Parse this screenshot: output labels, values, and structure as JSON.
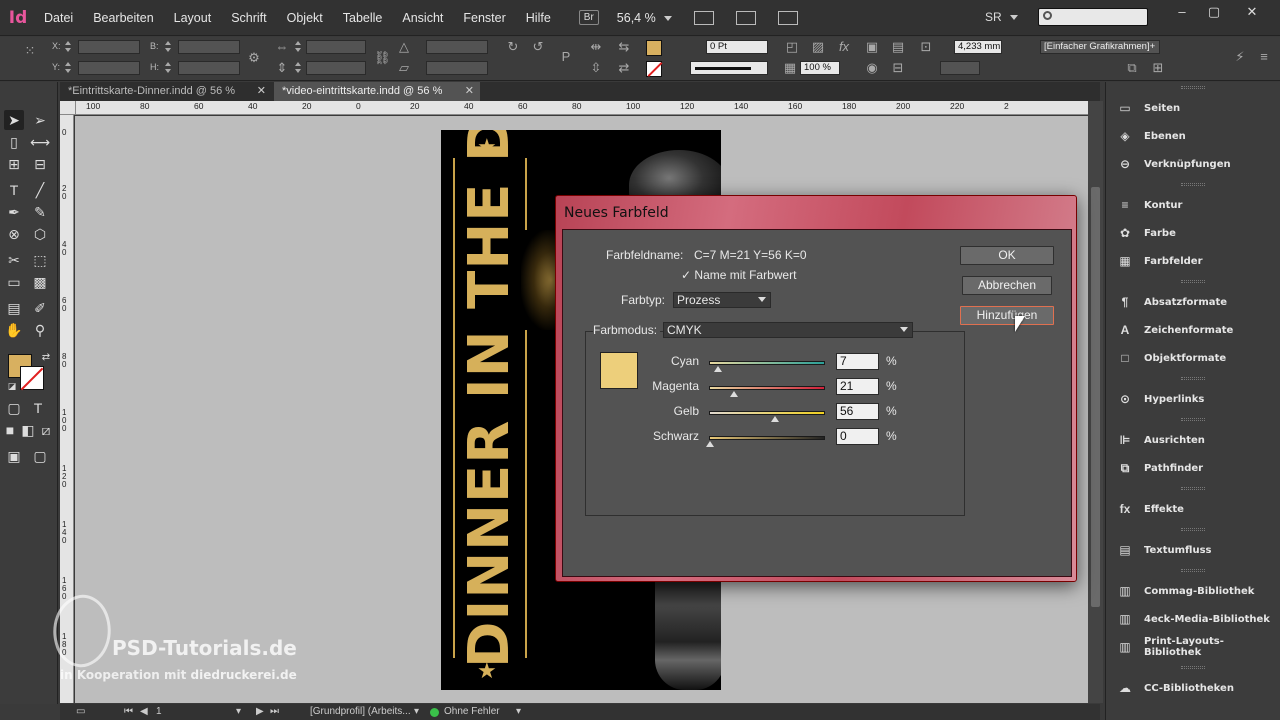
{
  "app": {
    "logo": "Id",
    "menu": [
      "Datei",
      "Bearbeiten",
      "Layout",
      "Schrift",
      "Objekt",
      "Tabelle",
      "Ansicht",
      "Fenster",
      "Hilfe"
    ],
    "bridge_label": "Br",
    "zoom": "56,4 %",
    "workspace": "SR",
    "window_controls": [
      "–",
      "▢",
      "✕"
    ]
  },
  "controlbar": {
    "x_label": "X:",
    "y_label": "Y:",
    "w_label": "B:",
    "h_label": "H:",
    "stroke_weight": "0 Pt",
    "opacity": "100 %",
    "dimension": "4,233 mm",
    "frame_style": "[Einfacher Grafikrahmen]+",
    "fill_color": "#d8b060"
  },
  "tabs": [
    {
      "label": "*Eintrittskarte-Dinner.indd @ 56 %",
      "close": "✕"
    },
    {
      "label": "*video-eintrittskarte.indd @ 56 %",
      "close": "✕"
    }
  ],
  "ruler": {
    "top": [
      "100",
      "80",
      "60",
      "40",
      "20",
      "0",
      "20",
      "40",
      "60",
      "80",
      "100",
      "120",
      "140",
      "160",
      "180",
      "200",
      "220",
      "2"
    ],
    "left": [
      "0",
      "2 0",
      "4 0",
      "6 0",
      "8 0",
      "1 0 0",
      "1 2 0",
      "1 4 0",
      "1 6 0",
      "1 8 0"
    ]
  },
  "document": {
    "headline": "DINNER IN THE DARK",
    "star": "★",
    "gold_color": "#d6b05a"
  },
  "watermark": {
    "brand": "PSD-Tutorials.de",
    "coop_prefix": "in Kooperation mit",
    "partner": "diedruckerei.de"
  },
  "statusbar": {
    "page": "1",
    "profile": "[Grundprofil] (Arbeits...",
    "errors": "Ohne Fehler"
  },
  "panels": [
    {
      "group": 1,
      "items": [
        {
          "label": "Seiten",
          "icon": "pages-icon",
          "glyph": "▭"
        },
        {
          "label": "Ebenen",
          "icon": "layers-icon",
          "glyph": "◈"
        },
        {
          "label": "Verknüpfungen",
          "icon": "links-icon",
          "glyph": "⊖"
        }
      ]
    },
    {
      "group": 2,
      "items": [
        {
          "label": "Kontur",
          "icon": "stroke-icon",
          "glyph": "≡"
        },
        {
          "label": "Farbe",
          "icon": "color-icon",
          "glyph": "✿"
        },
        {
          "label": "Farbfelder",
          "icon": "swatches-icon",
          "glyph": "▦"
        }
      ]
    },
    {
      "group": 3,
      "items": [
        {
          "label": "Absatzformate",
          "icon": "paragraph-styles-icon",
          "glyph": "¶"
        },
        {
          "label": "Zeichenformate",
          "icon": "character-styles-icon",
          "glyph": "A"
        },
        {
          "label": "Objektformate",
          "icon": "object-styles-icon",
          "glyph": "□"
        }
      ]
    },
    {
      "group": 4,
      "items": [
        {
          "label": "Hyperlinks",
          "icon": "hyperlinks-icon",
          "glyph": "⊙"
        }
      ]
    },
    {
      "group": 5,
      "items": [
        {
          "label": "Ausrichten",
          "icon": "align-icon",
          "glyph": "⊫"
        },
        {
          "label": "Pathfinder",
          "icon": "pathfinder-icon",
          "glyph": "⧉"
        }
      ]
    },
    {
      "group": 6,
      "items": [
        {
          "label": "Effekte",
          "icon": "effects-icon",
          "glyph": "fx"
        }
      ]
    },
    {
      "group": 7,
      "items": [
        {
          "label": "Textumfluss",
          "icon": "text-wrap-icon",
          "glyph": "▤"
        }
      ]
    },
    {
      "group": 8,
      "items": [
        {
          "label": "Commag-Bibliothek",
          "icon": "library-icon",
          "glyph": "▥"
        },
        {
          "label": "4eck-Media-Bibliothek",
          "icon": "library-icon",
          "glyph": "▥"
        },
        {
          "label": "Print-Layouts-Bibliothek",
          "icon": "library-icon",
          "glyph": "▥"
        }
      ]
    },
    {
      "group": 9,
      "items": [
        {
          "label": "CC-Bibliotheken",
          "icon": "cc-libraries-icon",
          "glyph": "☁"
        }
      ]
    }
  ],
  "dialog": {
    "title": "Neues Farbfeld",
    "swatch_name_label": "Farbfeldname:",
    "swatch_name_value": "C=7 M=21 Y=56 K=0",
    "name_with_value_check": "✓",
    "name_with_value_label": "Name mit Farbwert",
    "color_type_label": "Farbtyp:",
    "color_type_value": "Prozess",
    "color_mode_label": "Farbmodus:",
    "color_mode_value": "CMYK",
    "preview_color": "#edcf7b",
    "buttons": {
      "ok": "OK",
      "cancel": "Abbrechen",
      "add": "Hinzufügen"
    },
    "channels": [
      {
        "label": "Cyan",
        "value": "7",
        "unit": "%",
        "fraction": 0.07,
        "gradient": "linear-gradient(90deg,#e8d8a0,#2aa098)"
      },
      {
        "label": "Magenta",
        "value": "21",
        "unit": "%",
        "fraction": 0.21,
        "gradient": "linear-gradient(90deg,#e8d8a0,#d0203a)"
      },
      {
        "label": "Gelb",
        "value": "56",
        "unit": "%",
        "fraction": 0.56,
        "gradient": "linear-gradient(90deg,#e0d8d0,#f0d020)"
      },
      {
        "label": "Schwarz",
        "value": "0",
        "unit": "%",
        "fraction": 0.0,
        "gradient": "linear-gradient(90deg,#e8c878,#222)"
      }
    ]
  }
}
